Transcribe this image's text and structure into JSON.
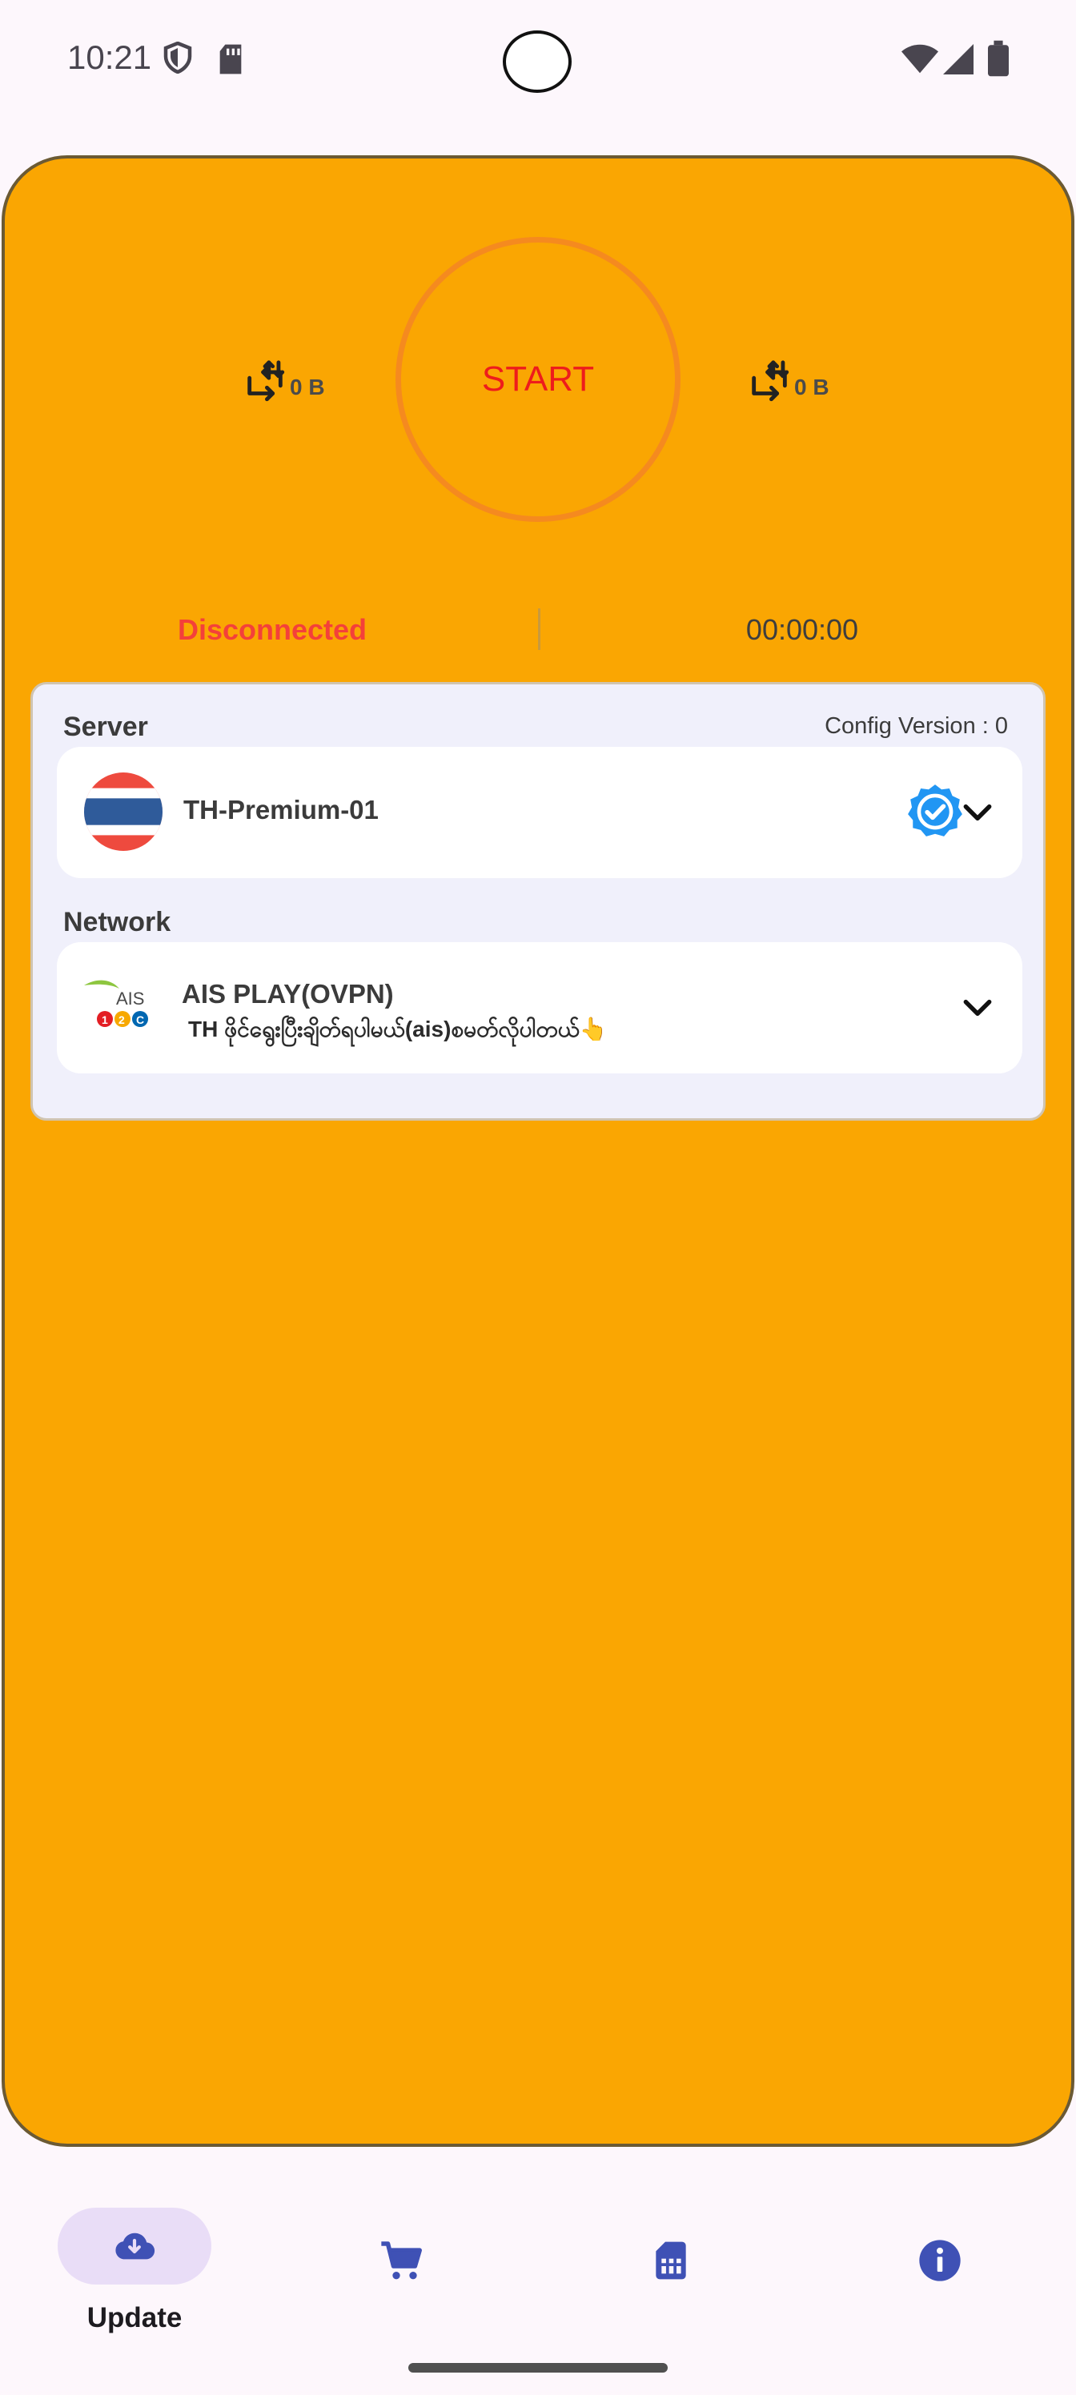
{
  "status_bar": {
    "time": "10:21",
    "icons": [
      "shield-icon",
      "sd-card-icon",
      "wifi-icon",
      "cell-signal-icon",
      "battery-icon"
    ]
  },
  "connection": {
    "start_label": "START",
    "upload_value": "0 B",
    "download_value": "0 B",
    "status": "Disconnected",
    "timer": "00:00:00"
  },
  "server": {
    "section_label": "Server",
    "config_version": "Config Version : 0",
    "name": "TH-Premium-01"
  },
  "network": {
    "section_label": "Network",
    "name": "AIS PLAY(OVPN)",
    "description": "TH ဖိုင်ရွေးပြီးချိတ်ရပါမယ်(ais)စမတ်လိုပါတယ်👆",
    "logo_text": "AIS"
  },
  "bottom_nav": {
    "items": [
      {
        "label": "Update",
        "icon": "cloud-download-icon",
        "active": true
      },
      {
        "label": "",
        "icon": "cart-icon",
        "active": false
      },
      {
        "label": "",
        "icon": "sim-card-icon",
        "active": false
      },
      {
        "label": "",
        "icon": "info-icon",
        "active": false
      }
    ]
  },
  "colors": {
    "card_bg": "#faa602",
    "start_text": "#ee1c1c",
    "disconnected": "#f4403a",
    "nav_icon": "#3f51b5",
    "active_pill": "#e9ddf7"
  }
}
